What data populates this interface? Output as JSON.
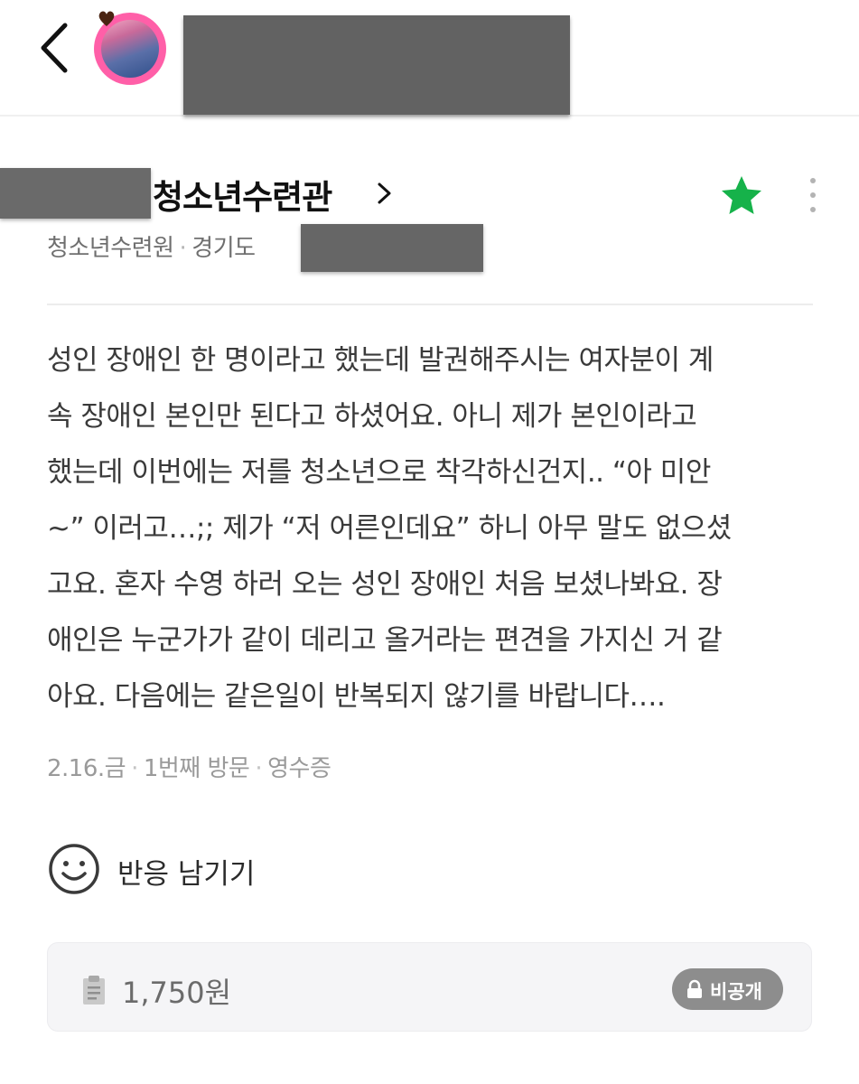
{
  "place": {
    "title": "청소년수련관",
    "category": "청소년수련원",
    "region": "경기도"
  },
  "review": {
    "lines": [
      "성인 장애인 한 명이라고 했는데 발권해주시는 여자분이 계",
      "속 장애인 본인만 된다고 하셨어요. 아니 제가 본인이라고",
      "했는데 이번에는 저를 청소년으로 착각하신건지.. “아 미안",
      "~” 이러고…;; 제가 “저 어른인데요” 하니 아무 말도 없으셨",
      "고요. 혼자 수영 하러 오는 성인 장애인 처음 보셨나봐요. 장",
      "애인은 누군가가 같이 데리고 올거라는 편견을 가지신 거 같",
      "아요. 다음에는 같은일이 반복되지 않기를 바랍니다…."
    ]
  },
  "visit": {
    "date": "2.16.금",
    "count": "1번째 방문",
    "proof": "영수증"
  },
  "reaction": {
    "label": "반응 남기기"
  },
  "receipt": {
    "amount": "1,750원",
    "privacy": "비공개"
  },
  "icons": {
    "back": "chevron-left-icon",
    "star": "star-icon",
    "more": "more-vertical-icon",
    "smile": "smile-icon",
    "receipt": "clipboard-icon",
    "lock": "lock-icon"
  },
  "colors": {
    "star": "#16b24a",
    "badge": "#8d8d8d"
  }
}
